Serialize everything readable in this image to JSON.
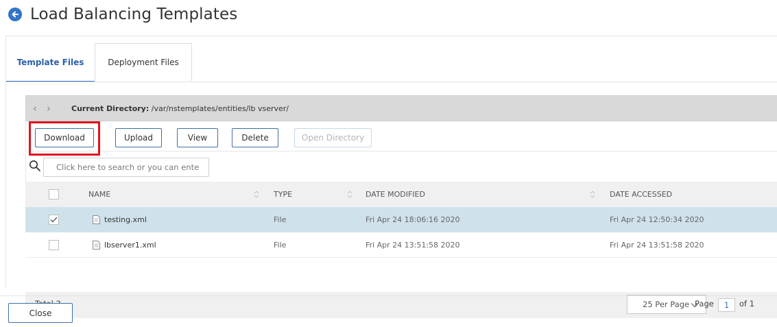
{
  "header": {
    "title": "Load Balancing Templates",
    "back_icon": "back-arrow-circle-icon"
  },
  "tabs": [
    {
      "label": "Template Files",
      "active": true
    },
    {
      "label": "Deployment Files",
      "active": false
    }
  ],
  "directory": {
    "label": "Current Directory:",
    "path": "/var/nstemplates/entities/lb vserver/"
  },
  "toolbar": {
    "download": "Download",
    "upload": "Upload",
    "view": "View",
    "delete": "Delete",
    "open_directory": "Open Directory"
  },
  "search": {
    "placeholder": "Click here to search or you can ente"
  },
  "table": {
    "columns": [
      "NAME",
      "TYPE",
      "DATE MODIFIED",
      "DATE ACCESSED"
    ],
    "rows": [
      {
        "selected": true,
        "name": "testing.xml",
        "type": "File",
        "modified": "Fri Apr 24 18:06:16 2020",
        "accessed": "Fri Apr 24 12:50:34 2020"
      },
      {
        "selected": false,
        "name": "lbserver1.xml",
        "type": "File",
        "modified": "Fri Apr 24 13:51:58 2020",
        "accessed": "Fri Apr 24 13:51:58 2020"
      }
    ]
  },
  "footer": {
    "total": "Total 3",
    "per_page": "25 Per Page",
    "page_label": "Page",
    "page_value": "1",
    "of_label": "of 1"
  },
  "actions": {
    "close": "Close"
  },
  "colors": {
    "accent": "#3274c9",
    "highlight": "#e0141e",
    "selected_row": "#cfe2ec"
  }
}
